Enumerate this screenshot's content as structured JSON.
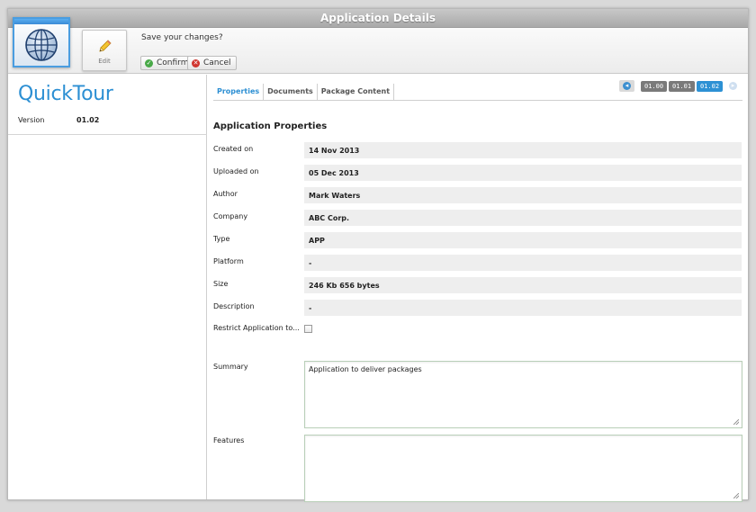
{
  "window": {
    "title": "Application Details"
  },
  "toolbar": {
    "edit_label": "Edit",
    "save_question": "Save your changes?",
    "confirm_label": "Confirm",
    "cancel_label": "Cancel"
  },
  "app": {
    "name": "QuickTour",
    "version_label": "Version",
    "version_value": "01.02"
  },
  "tabs": [
    {
      "label": "Properties",
      "active": true
    },
    {
      "label": "Documents",
      "active": false
    },
    {
      "label": "Package Content",
      "active": false
    }
  ],
  "versions": [
    {
      "label": "01.00",
      "active": false
    },
    {
      "label": "01.01",
      "active": false
    },
    {
      "label": "01.02",
      "active": true
    }
  ],
  "properties": {
    "title": "Application Properties",
    "rows": [
      {
        "label": "Created on",
        "value": "14 Nov 2013"
      },
      {
        "label": "Uploaded on",
        "value": "05 Dec 2013"
      },
      {
        "label": "Author",
        "value": "Mark Waters"
      },
      {
        "label": "Company",
        "value": "ABC Corp."
      },
      {
        "label": "Type",
        "value": "APP"
      },
      {
        "label": "Platform",
        "value": "-"
      },
      {
        "label": "Size",
        "value": "246 Kb 656 bytes"
      },
      {
        "label": "Description",
        "value": "-"
      }
    ],
    "restrict_label": "Restrict Application to...",
    "restrict_checked": false,
    "summary_label": "Summary",
    "summary_value": "Application to deliver packages",
    "features_label": "Features",
    "features_value": ""
  },
  "colors": {
    "accent": "#2c8fd3",
    "confirm": "#49a948",
    "cancel": "#d0352f",
    "title_bar": "#b0b0b0"
  }
}
